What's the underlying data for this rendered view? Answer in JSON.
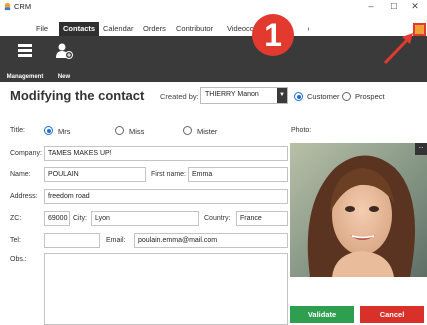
{
  "window": {
    "title": "CRM",
    "controls": {
      "minimize": "–",
      "maximize": "☐",
      "close": "✕"
    }
  },
  "menu": {
    "items": [
      "File",
      "Contacts",
      "Calendar",
      "Orders",
      "Contributor",
      "Videocon",
      "elp"
    ],
    "active": "Contacts"
  },
  "toolbar": {
    "management_label": "Management",
    "new_label": "New"
  },
  "form": {
    "heading": "Modifying the contact",
    "created_by_label": "Created by:",
    "created_by_value": "THIERRY Manon",
    "type_options": {
      "customer": "Customer",
      "prospect": "Prospect",
      "selected": "Customer"
    },
    "title_label": "Title:",
    "title_options": {
      "mrs": "Mrs",
      "miss": "Miss",
      "mister": "Mister",
      "selected": "Mrs"
    },
    "photo_label": "Photo:",
    "company_label": "Company:",
    "company_value": "TAMES MAKES UP!",
    "name_label": "Name:",
    "name_value": "POULAIN",
    "first_name_label": "First name:",
    "first_name_value": "Emma",
    "address_label": "Address:",
    "address_value": "freedom road",
    "zc_label": "ZC:",
    "zc_value": "69000",
    "city_label": "City:",
    "city_value": "Lyon",
    "country_label": "Country:",
    "country_value": "France",
    "tel_label": "Tel:",
    "tel_value": "",
    "email_label": "Email:",
    "email_value": "poulain.emma@mail.com",
    "obs_label": "Obs.:",
    "obs_value": "",
    "photo_more": "..."
  },
  "actions": {
    "validate_label": "Validate",
    "cancel_label": "Cancel"
  },
  "annotation": {
    "badge": "1"
  },
  "colors": {
    "toolbar": "#3a3a3a",
    "validate": "#2e9e4f",
    "cancel": "#d9302a",
    "radio": "#1f6fd0",
    "annotation": "#e23a2e"
  }
}
